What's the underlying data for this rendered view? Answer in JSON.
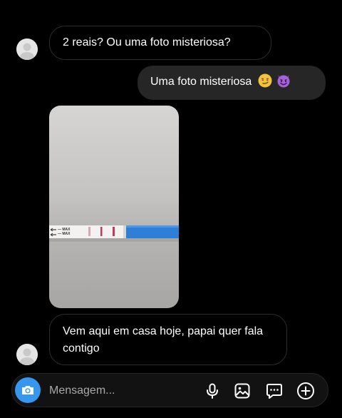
{
  "thread": {
    "messages": [
      {
        "direction": "received",
        "text": "2 reais? Ou uma foto misteriosa?"
      },
      {
        "direction": "sent",
        "text": "Uma foto misteriosa",
        "emojis": [
          "smirking-face",
          "smiling-face-with-horns"
        ]
      },
      {
        "direction": "received",
        "type": "photo",
        "photo_label": "— MAX\n— MAX"
      },
      {
        "direction": "received",
        "text": "Vem aqui em casa hoje, papai quer fala contigo"
      }
    ]
  },
  "composer": {
    "placeholder": "Mensagem...",
    "value": "",
    "icons": [
      "camera-icon",
      "microphone-icon",
      "gallery-icon",
      "sticker-icon",
      "add-icon"
    ]
  },
  "colors": {
    "background": "#000000",
    "sent_bubble": "#262626",
    "received_border": "#2d2d2d",
    "camera_button": "#3797f0",
    "test_strip_blue": "#2f7fd6",
    "test_lines": "#c23b5a"
  }
}
